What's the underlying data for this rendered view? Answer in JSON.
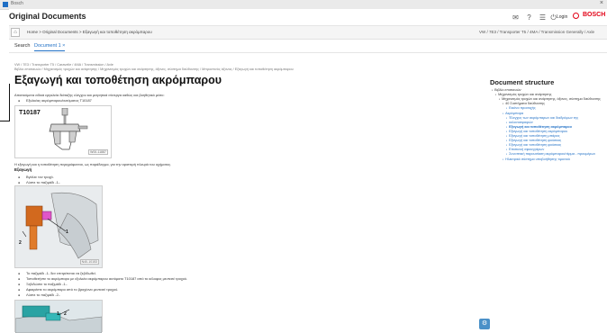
{
  "window": {
    "title": "Bosch",
    "close": "×"
  },
  "header": {
    "title": "Original Documents",
    "icons": [
      "mail-icon",
      "help-icon",
      "settings-icon",
      "power-icon"
    ],
    "login": "Login",
    "brand": "BOSCH"
  },
  "breadcrumb": {
    "home_glyph": "⌂",
    "path": "Home > Original Documents > Εξαγωγή και τοποθέτηση ακρόμπαρου",
    "vehicle": "VW / 7E3 / Transporter T5 / 4MA / Transmission Generally / Axle"
  },
  "tabs": [
    {
      "label": "Search"
    },
    {
      "label": "Document 1 ×"
    }
  ],
  "document": {
    "meta_line_1": "VW / 7E3 / Transporter T5 / Caravelle / 4MA / Transmission / Axle",
    "meta_line_2": "Βιβλίο επισκευών / Μηχανισμός τροχών και ανάρτησης / Μηχανισμός τροχών και ανάρτησης, άξονες, σύστημα διεύθυνσης / Μπροστινός άξονας / Εξαγωγή και τοποθέτηση ακρόμπαρου",
    "title": "Εξαγωγή και τοποθέτηση ακρόμπαρου",
    "tools_intro": "Απαιτούμενα ειδικά εργαλεία διάταξης ελέγχου και μετρητικά σύνεργα καθώς και βοηθητικό μέσο:",
    "tool_item": "Εξολκέας ακρόμπαρου/αυτόματος T10187",
    "figure1_label": "T10187",
    "figure1_id": "W00-11887",
    "removal_note": "Η εξαγωγή και η τοποθέτηση περιγράφονται, ως παράδειγμα, για την αριστερή πλευρά του οχήματος.",
    "section_heading": "Εξαγωγή",
    "steps_before": [
      "Βγάλτε τον τροχό.",
      "Λύστε το παξιμάδι -1-."
    ],
    "figure2_id": "N40-10153",
    "figure2_callouts": [
      "1",
      "2"
    ],
    "steps_after": [
      "Το παξιμάδι -1- δεν επιτρέπεται να ξεβιδωθεί.",
      "Τοποθετήστε το ακρόμπαρο με εξολκέα ακρόμπαρου αυτόματο T10187 από το κέλυφος μεντεσέ τροχού.",
      "Ξεβιδώστε το παξιμάδι -1-.",
      "Αφαιρέστε το ακρόμπαρο από το βραχίονα μεντεσέ τροχού.",
      "Λύστε το παξιμάδι -2-."
    ],
    "figure3_callouts": [
      "1",
      "2"
    ]
  },
  "structure": {
    "title": "Document structure",
    "items": [
      {
        "label": "Βιβλίο επισκευών",
        "level": 0,
        "state": "normal"
      },
      {
        "label": "Μηχανισμός τροχών και ανάρτησης",
        "level": 1,
        "state": "normal"
      },
      {
        "label": "Μηχανισμός τροχών και ανάρτησης, άξονες, σύστημα διεύθυνσης",
        "level": 2,
        "state": "normal"
      },
      {
        "label": "40 Συστήματα διεύθυνσης",
        "level": 3,
        "state": "normal"
      },
      {
        "label": "Εικόνα προσοχής",
        "level": 4,
        "state": "link"
      },
      {
        "label": "Ακρόμπαρα",
        "level": 3,
        "state": "link"
      },
      {
        "label": "Έλεγχος των ακρόμπαρων και διαδρόμων της",
        "level": 4,
        "state": "link"
      },
      {
        "label": "κολονοσφαιρών",
        "level": 4,
        "state": "link"
      },
      {
        "label": "Εξαγωγή και τοποθέτηση ακρόμπαρου",
        "level": 4,
        "state": "current"
      },
      {
        "label": "Εξαγωγή και τοποθέτηση ακρόμπαρου",
        "level": 4,
        "state": "link"
      },
      {
        "label": "Εξαγωγή και τοποθέτηση μπάρας",
        "level": 4,
        "state": "link"
      },
      {
        "label": "Εξαγωγή και τοποθέτηση φούσκας",
        "level": 4,
        "state": "link"
      },
      {
        "label": "Εξαγωγή και τοποθέτηση φούσκας",
        "level": 4,
        "state": "link"
      },
      {
        "label": "Επισκευή σφουγγάρων",
        "level": 4,
        "state": "link"
      },
      {
        "label": "Συνοπτική παρουσίαση ακρόμπαρου/τέρμα - προυμέρων",
        "level": 4,
        "state": "link"
      },
      {
        "label": "Ηλεκτρικό σύστημα υποβοήθησης τιμονιού",
        "level": 3,
        "state": "link"
      }
    ]
  },
  "fab": {
    "glyph": "⚙"
  },
  "colors": {
    "accent": "#1f6fc5",
    "brand": "#e20015"
  }
}
